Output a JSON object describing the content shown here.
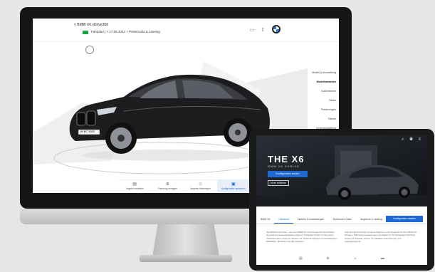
{
  "imac": {
    "header": {
      "back_link": "< BMW X6 xDrive30d",
      "meta": "Fahrplan  |  > 17.09.2024  > Preismodul & Leasing"
    },
    "side_menu": [
      {
        "label": "Modell & Ausstattung"
      },
      {
        "label": "Modellvarianten",
        "active": true
      },
      {
        "label": "Außenfarben"
      },
      {
        "label": "Räder"
      },
      {
        "label": "Polsterungen"
      },
      {
        "label": "Pakete"
      },
      {
        "label": "Innenausstattung"
      }
    ],
    "bottom_tabs": [
      {
        "label": "Angebot erstellen",
        "icon": "form-icon"
      },
      {
        "label": "Fahrzeug anfragen",
        "icon": "globe-icon"
      },
      {
        "label": "Angebot hinterlegen",
        "icon": "person-icon"
      },
      {
        "label": "Konfiguration speichern",
        "icon": "save-icon",
        "active": true
      }
    ],
    "license_plate": "M·BC 5002"
  },
  "ipad": {
    "hero": {
      "title": "THE X6",
      "subtitle": "BMW X6 XDRIVE",
      "primary_button": "Konfiguration starten",
      "secondary_button": "Mehr erfahren"
    },
    "tabs": [
      {
        "label": "BMW X6",
        "active": true
      },
      {
        "label": "Übersicht"
      },
      {
        "label": "Modelle & Ausstattungen"
      },
      {
        "label": "Technische Daten"
      },
      {
        "label": "Angebote & Leasing"
      }
    ],
    "cta": "Konfiguration starten",
    "body_left": "Sportlichkeit verbinden – der neue BMW X6 mit überragender Sportlichkeit, Dynamik und ausdrucksstarker Präsenz. Kraftvolles Design mit der neuen, markanten Niere sowie ein Interieur mit modernen Displays und hochwertigen Materialien. Entdecken Sie alle Varianten.",
    "body_right": "Jetzt den Sports Activity Coupé konfigurieren oder Angebote für Ihren BMW X6 anfragen. Zahlreiche Ausstattungen und Pakete für Ihr individuelles Fahrzeug stehen zur Auswahl, ebenso wie attraktive Finanzierungs- und Leasingangebote."
  },
  "colors": {
    "bmw_blue": "#1c69d4",
    "status_green": "#1aa34a"
  }
}
